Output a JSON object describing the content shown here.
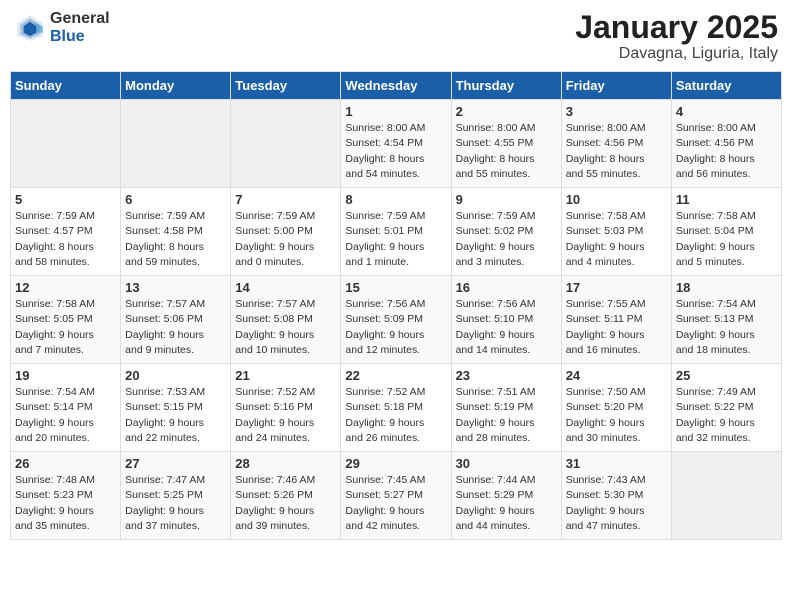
{
  "header": {
    "logo_general": "General",
    "logo_blue": "Blue",
    "month": "January 2025",
    "location": "Davagna, Liguria, Italy"
  },
  "weekdays": [
    "Sunday",
    "Monday",
    "Tuesday",
    "Wednesday",
    "Thursday",
    "Friday",
    "Saturday"
  ],
  "weeks": [
    [
      {
        "day": "",
        "info": ""
      },
      {
        "day": "",
        "info": ""
      },
      {
        "day": "",
        "info": ""
      },
      {
        "day": "1",
        "info": "Sunrise: 8:00 AM\nSunset: 4:54 PM\nDaylight: 8 hours\nand 54 minutes."
      },
      {
        "day": "2",
        "info": "Sunrise: 8:00 AM\nSunset: 4:55 PM\nDaylight: 8 hours\nand 55 minutes."
      },
      {
        "day": "3",
        "info": "Sunrise: 8:00 AM\nSunset: 4:56 PM\nDaylight: 8 hours\nand 55 minutes."
      },
      {
        "day": "4",
        "info": "Sunrise: 8:00 AM\nSunset: 4:56 PM\nDaylight: 8 hours\nand 56 minutes."
      }
    ],
    [
      {
        "day": "5",
        "info": "Sunrise: 7:59 AM\nSunset: 4:57 PM\nDaylight: 8 hours\nand 58 minutes."
      },
      {
        "day": "6",
        "info": "Sunrise: 7:59 AM\nSunset: 4:58 PM\nDaylight: 8 hours\nand 59 minutes."
      },
      {
        "day": "7",
        "info": "Sunrise: 7:59 AM\nSunset: 5:00 PM\nDaylight: 9 hours\nand 0 minutes."
      },
      {
        "day": "8",
        "info": "Sunrise: 7:59 AM\nSunset: 5:01 PM\nDaylight: 9 hours\nand 1 minute."
      },
      {
        "day": "9",
        "info": "Sunrise: 7:59 AM\nSunset: 5:02 PM\nDaylight: 9 hours\nand 3 minutes."
      },
      {
        "day": "10",
        "info": "Sunrise: 7:58 AM\nSunset: 5:03 PM\nDaylight: 9 hours\nand 4 minutes."
      },
      {
        "day": "11",
        "info": "Sunrise: 7:58 AM\nSunset: 5:04 PM\nDaylight: 9 hours\nand 5 minutes."
      }
    ],
    [
      {
        "day": "12",
        "info": "Sunrise: 7:58 AM\nSunset: 5:05 PM\nDaylight: 9 hours\nand 7 minutes."
      },
      {
        "day": "13",
        "info": "Sunrise: 7:57 AM\nSunset: 5:06 PM\nDaylight: 9 hours\nand 9 minutes."
      },
      {
        "day": "14",
        "info": "Sunrise: 7:57 AM\nSunset: 5:08 PM\nDaylight: 9 hours\nand 10 minutes."
      },
      {
        "day": "15",
        "info": "Sunrise: 7:56 AM\nSunset: 5:09 PM\nDaylight: 9 hours\nand 12 minutes."
      },
      {
        "day": "16",
        "info": "Sunrise: 7:56 AM\nSunset: 5:10 PM\nDaylight: 9 hours\nand 14 minutes."
      },
      {
        "day": "17",
        "info": "Sunrise: 7:55 AM\nSunset: 5:11 PM\nDaylight: 9 hours\nand 16 minutes."
      },
      {
        "day": "18",
        "info": "Sunrise: 7:54 AM\nSunset: 5:13 PM\nDaylight: 9 hours\nand 18 minutes."
      }
    ],
    [
      {
        "day": "19",
        "info": "Sunrise: 7:54 AM\nSunset: 5:14 PM\nDaylight: 9 hours\nand 20 minutes."
      },
      {
        "day": "20",
        "info": "Sunrise: 7:53 AM\nSunset: 5:15 PM\nDaylight: 9 hours\nand 22 minutes."
      },
      {
        "day": "21",
        "info": "Sunrise: 7:52 AM\nSunset: 5:16 PM\nDaylight: 9 hours\nand 24 minutes."
      },
      {
        "day": "22",
        "info": "Sunrise: 7:52 AM\nSunset: 5:18 PM\nDaylight: 9 hours\nand 26 minutes."
      },
      {
        "day": "23",
        "info": "Sunrise: 7:51 AM\nSunset: 5:19 PM\nDaylight: 9 hours\nand 28 minutes."
      },
      {
        "day": "24",
        "info": "Sunrise: 7:50 AM\nSunset: 5:20 PM\nDaylight: 9 hours\nand 30 minutes."
      },
      {
        "day": "25",
        "info": "Sunrise: 7:49 AM\nSunset: 5:22 PM\nDaylight: 9 hours\nand 32 minutes."
      }
    ],
    [
      {
        "day": "26",
        "info": "Sunrise: 7:48 AM\nSunset: 5:23 PM\nDaylight: 9 hours\nand 35 minutes."
      },
      {
        "day": "27",
        "info": "Sunrise: 7:47 AM\nSunset: 5:25 PM\nDaylight: 9 hours\nand 37 minutes."
      },
      {
        "day": "28",
        "info": "Sunrise: 7:46 AM\nSunset: 5:26 PM\nDaylight: 9 hours\nand 39 minutes."
      },
      {
        "day": "29",
        "info": "Sunrise: 7:45 AM\nSunset: 5:27 PM\nDaylight: 9 hours\nand 42 minutes."
      },
      {
        "day": "30",
        "info": "Sunrise: 7:44 AM\nSunset: 5:29 PM\nDaylight: 9 hours\nand 44 minutes."
      },
      {
        "day": "31",
        "info": "Sunrise: 7:43 AM\nSunset: 5:30 PM\nDaylight: 9 hours\nand 47 minutes."
      },
      {
        "day": "",
        "info": ""
      }
    ]
  ]
}
